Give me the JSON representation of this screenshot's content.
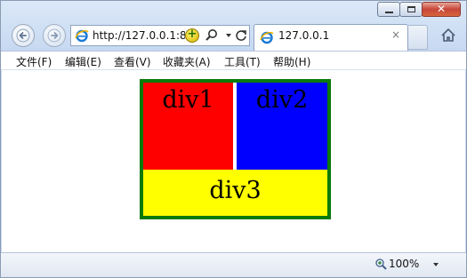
{
  "window": {
    "minimize_icon": "minimize-icon",
    "maximize_icon": "maximize-icon",
    "close_icon": "close-icon",
    "close_glyph": "✕"
  },
  "nav": {
    "back_icon": "back-arrow-icon",
    "forward_icon": "forward-arrow-icon",
    "address": "http://127.0.0.1:8",
    "search_icon": "search-icon",
    "refresh_icon": "refresh-icon",
    "home_icon": "home-icon",
    "compat_icon": "compat-view-icon",
    "compat_glyph": "+"
  },
  "tab": {
    "label": "127.0.0.1",
    "close": "×"
  },
  "menu": {
    "items": [
      "文件(F)",
      "编辑(E)",
      "查看(V)",
      "收藏夹(A)",
      "工具(T)",
      "帮助(H)"
    ]
  },
  "page": {
    "div1": "div1",
    "div2": "div2",
    "div3": "div3",
    "colors": {
      "div1": "#ff0000",
      "div2": "#0000ff",
      "div3": "#ffff00",
      "border": "#0a7a0a"
    }
  },
  "status": {
    "zoom": "100%",
    "zoom_icon": "zoom-icon"
  }
}
